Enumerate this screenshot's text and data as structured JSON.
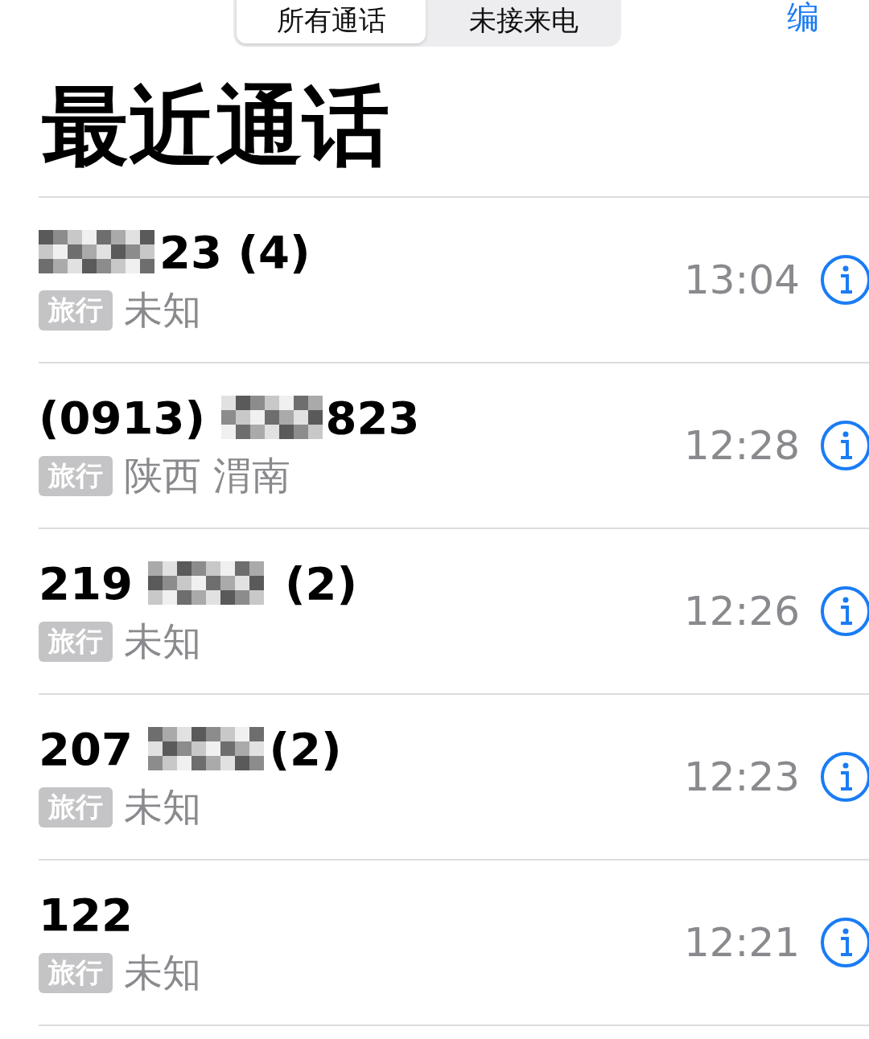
{
  "segments": [
    {
      "label": "所有通话",
      "selected": true
    },
    {
      "label": "未接来电",
      "selected": false
    }
  ],
  "edit_button": "编",
  "title": "最近通话",
  "calls": [
    {
      "redacted": true,
      "number_end": "23 (4)",
      "tag": "旅行",
      "location": "未知",
      "time": "13:04"
    },
    {
      "number_start": "(0913) ",
      "redacted": true,
      "number_end": "823",
      "tag": "旅行",
      "location": "陕西 渭南",
      "time": "12:28"
    },
    {
      "number_start": "219 ",
      "redacted": true,
      "number_end": " (2)",
      "tag": "旅行",
      "location": "未知",
      "time": "12:26"
    },
    {
      "number_start": "207 ",
      "redacted": true,
      "number_end": "(2)",
      "tag": "旅行",
      "location": "未知",
      "time": "12:23"
    },
    {
      "number_start": "122",
      "redacted": false,
      "tag": "旅行",
      "location": "未知",
      "time": "12:21"
    }
  ]
}
